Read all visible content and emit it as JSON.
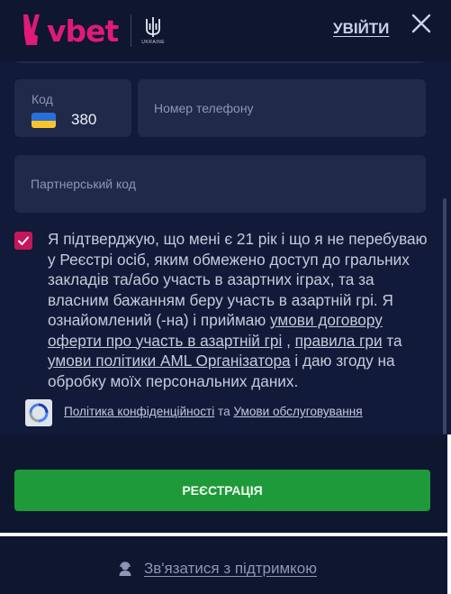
{
  "header": {
    "logo_text": "vbet",
    "emblem_caption": "UKRAINE",
    "login_label": "УВІЙТИ"
  },
  "form": {
    "country_code_label": "Код",
    "country_code_value": "380",
    "phone_placeholder": "Номер телефону",
    "partner_code_placeholder": "Партнерський код",
    "consent_checked": true,
    "consent": {
      "text_1": "Я підтверджую, що мені є 21 рік і що я не перебуваю у Реєстрі осіб, яким обмежено доступ до гральних закладів та/або участь в азартних іграх, та за власним бажанням беру участь в азартній грі. Я ознайомлений (-на) і приймаю ",
      "link_offer": "умови договору оферти про участь в азартній грі",
      "text_2": " , ",
      "link_rules": "правила гри",
      "text_3": " та ",
      "link_aml": "умови політики AML Організатора",
      "text_4": " і даю згоду на обробку моїх персональних даних."
    },
    "policy": {
      "privacy_label": "Політика конфіденційності",
      "and": " та ",
      "terms_label": "Умови обслуговування"
    },
    "register_label": "РЕЄСТРАЦІЯ"
  },
  "support": {
    "label": "Зв'язатися з підтримкою"
  },
  "colors": {
    "brand": "#e01a76",
    "background": "#0e1630",
    "field": "#1f2a4a",
    "checkbox": "#c2185b",
    "register": "#1e9a3a"
  },
  "icons": [
    "victory-hand-logo-icon",
    "trident-emblem-icon",
    "close-icon",
    "ukraine-flag-icon",
    "check-icon",
    "recaptcha-icon",
    "support-agent-icon"
  ]
}
